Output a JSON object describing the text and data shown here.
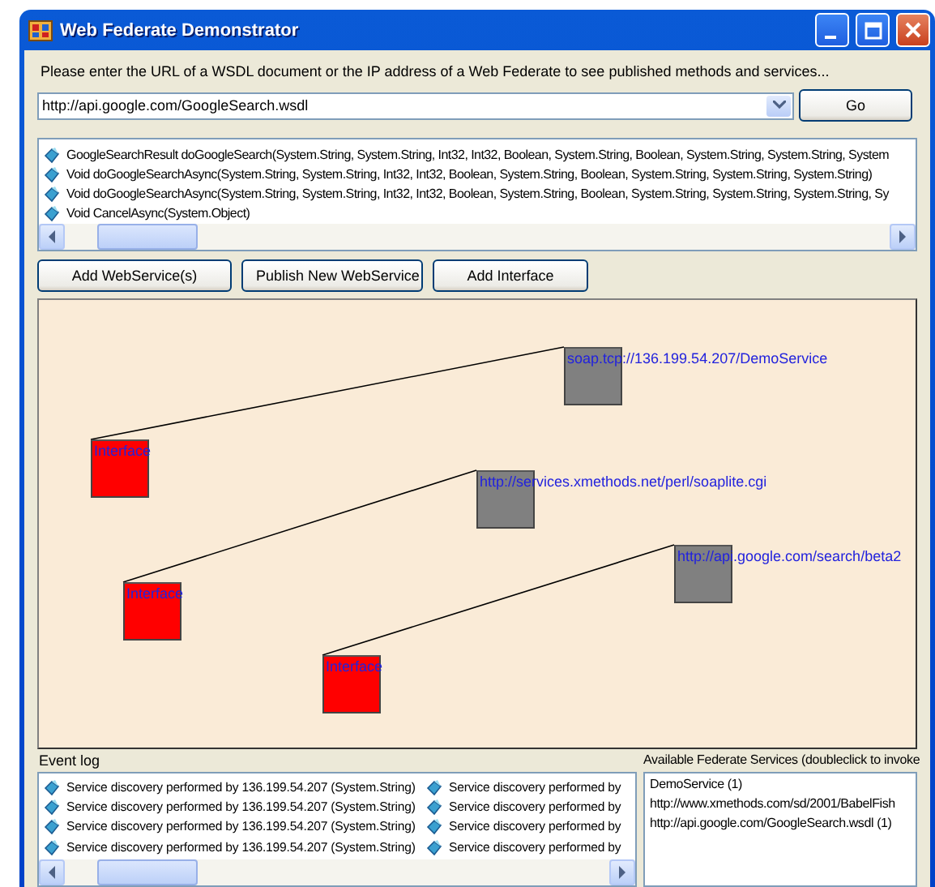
{
  "window": {
    "title": "Web Federate Demonstrator"
  },
  "prompt": "Please enter the URL of a WSDL document or the IP address of a Web Federate to see published methods and services...",
  "url_field": {
    "value": "http://api.google.com/GoogleSearch.wsdl"
  },
  "go_button": "Go",
  "methods": [
    {
      "text": "GoogleSearchResult doGoogleSearch(System.String, System.String, Int32, Int32, Boolean, System.String, Boolean, System.String, System.String, System"
    },
    {
      "text": "Void doGoogleSearchAsync(System.String, System.String, Int32, Int32, Boolean, System.String, Boolean, System.String, System.String, System.String)"
    },
    {
      "text": "Void doGoogleSearchAsync(System.String, System.String, Int32, Int32, Boolean, System.String, Boolean, System.String, System.String, System.String, Sy"
    },
    {
      "text": "Void CancelAsync(System.Object)"
    }
  ],
  "buttons": [
    "Add WebService(s)",
    "Publish New WebService",
    "Add Interface"
  ],
  "diagram": {
    "links": [
      {
        "interface": "Interface",
        "service": "soap.tcp://136.199.54.207/DemoService"
      },
      {
        "interface": "Interface",
        "service": "http://services.xmethods.net/perl/soaplite.cgi"
      },
      {
        "interface": "Interface",
        "service": "http://api.google.com/search/beta2"
      }
    ]
  },
  "event_log": {
    "label": "Event log",
    "column_1": [
      "Service discovery performed by 136.199.54.207 (System.String)",
      "Service discovery performed by 136.199.54.207 (System.String)",
      "Service discovery performed by 136.199.54.207 (System.String)",
      "Service discovery performed by 136.199.54.207 (System.String)"
    ],
    "column_2": [
      "Service discovery performed by",
      "Service discovery performed by",
      "Service discovery performed by",
      "Service discovery performed by"
    ]
  },
  "services": {
    "label": "Available Federate Services (doubleclick to invoke",
    "items": [
      "DemoService (1)",
      "http://www.xmethods.com/sd/2001/BabelFish",
      "http://api.google.com/GoogleSearch.wsdl (1)"
    ]
  }
}
